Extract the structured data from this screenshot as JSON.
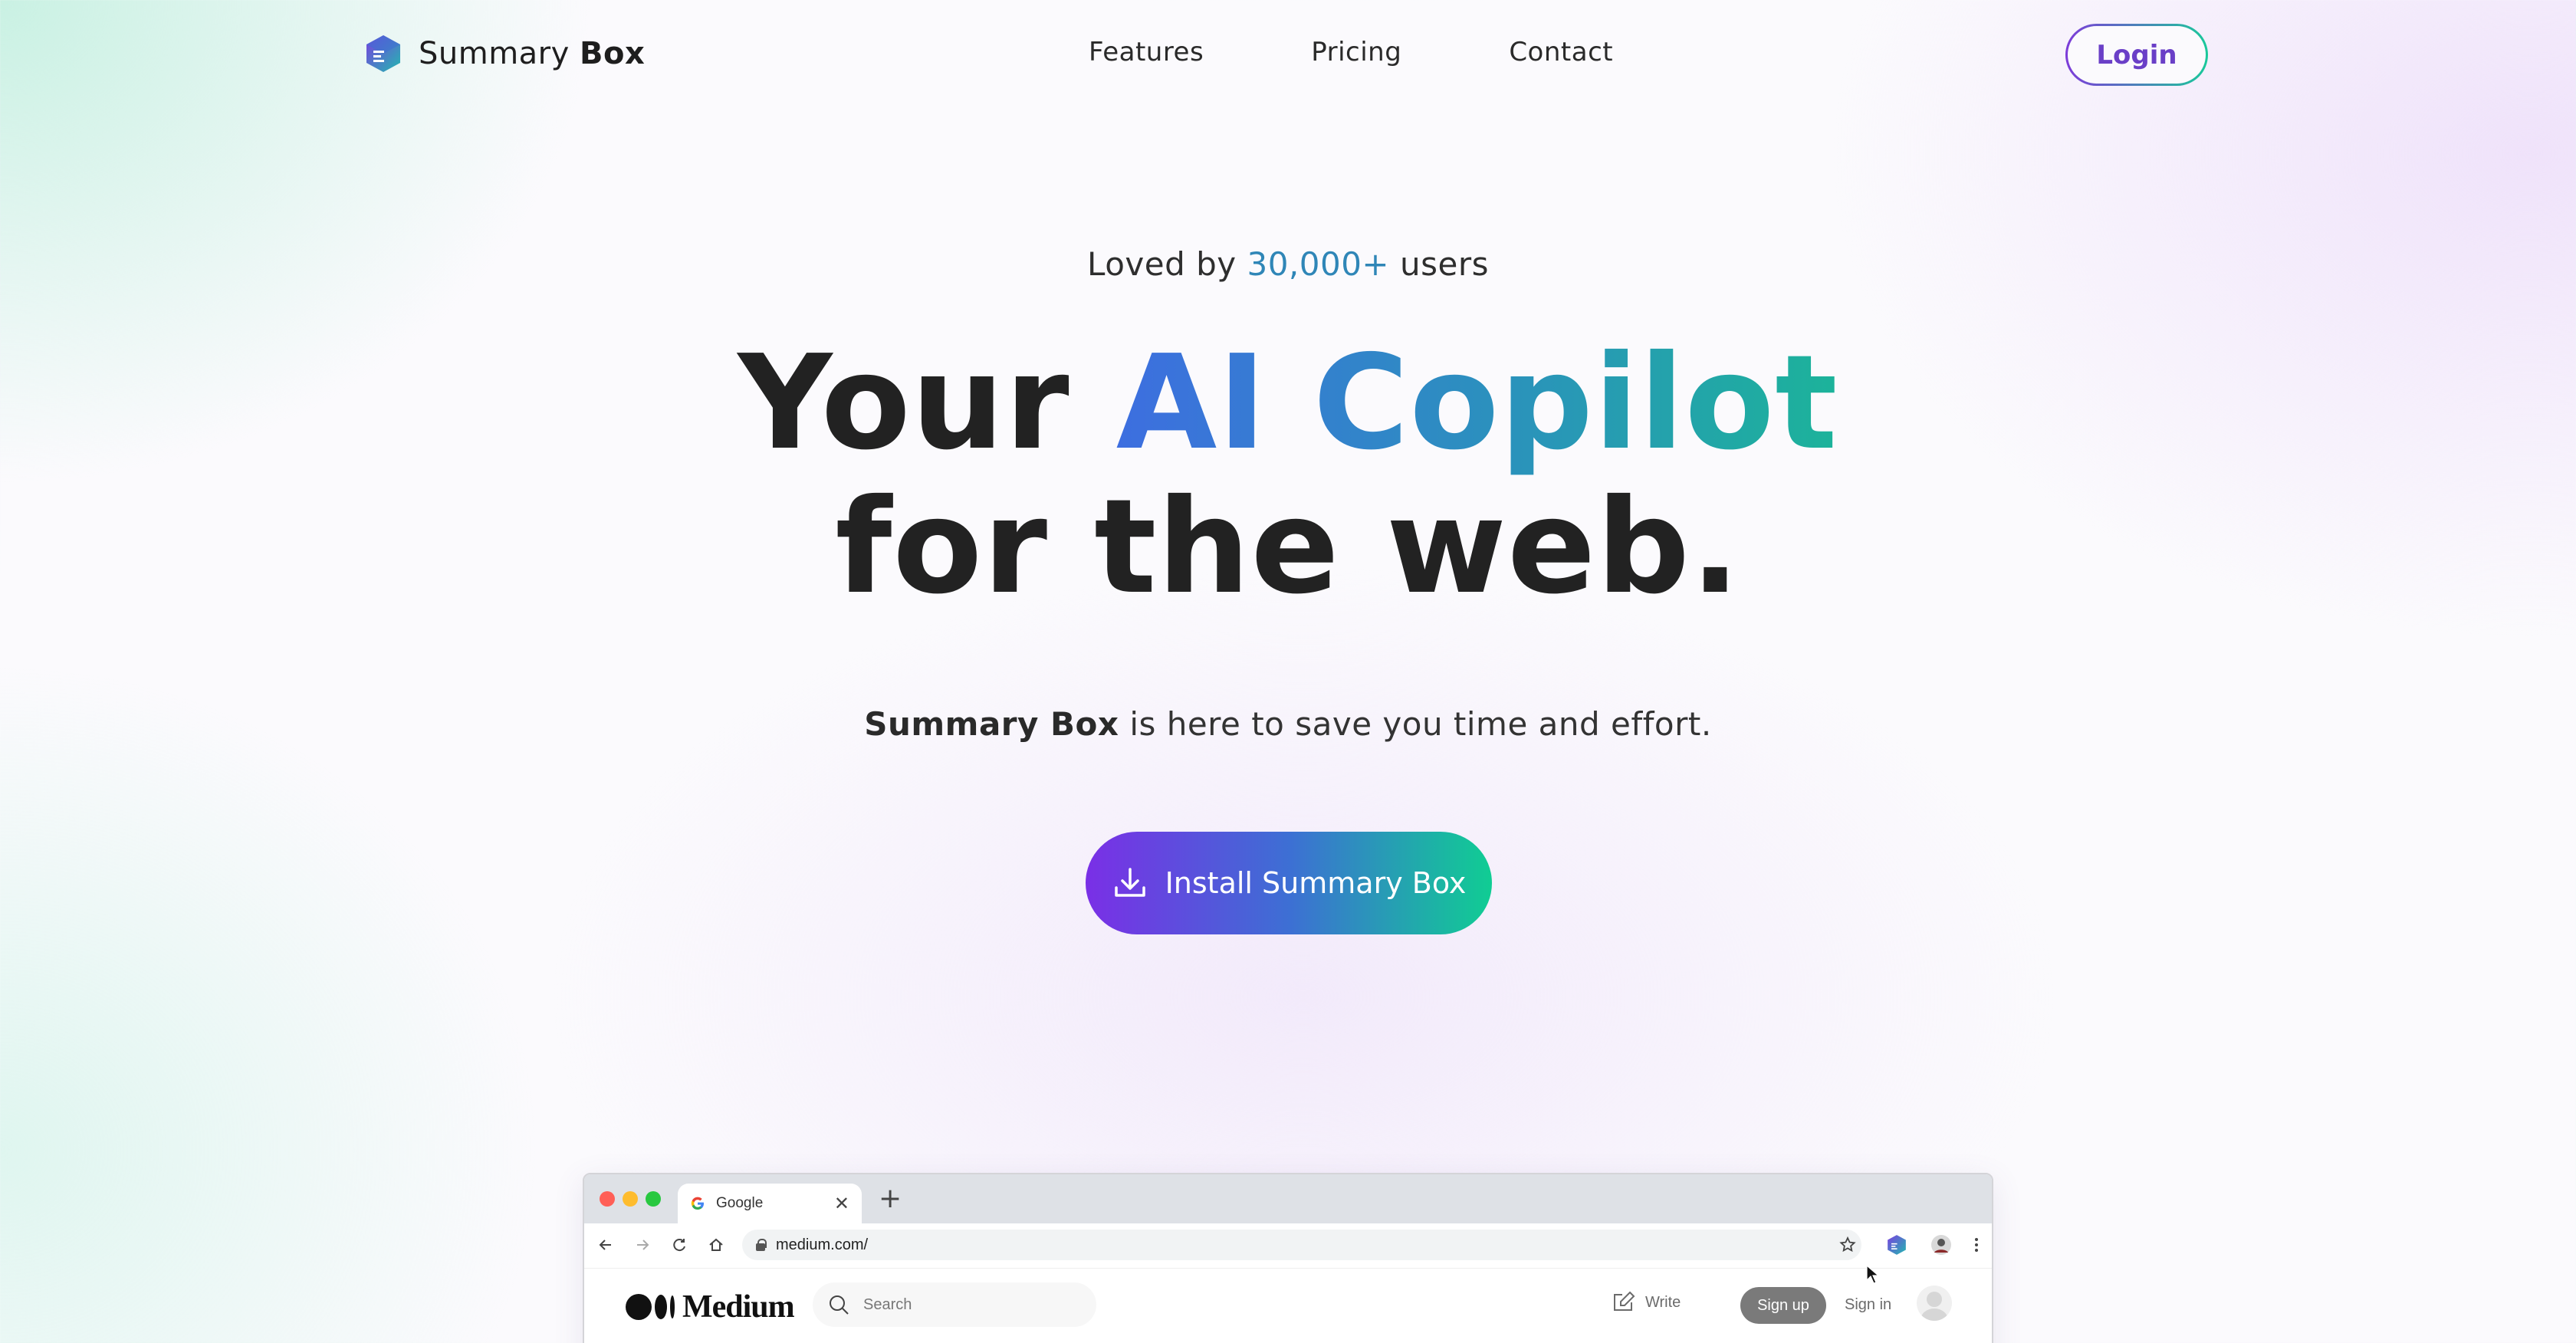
{
  "brand": {
    "name_regular": "Summary ",
    "name_bold": "Box"
  },
  "nav": {
    "links": [
      "Features",
      "Pricing",
      "Contact"
    ],
    "login_label": "Login"
  },
  "hero": {
    "loved_prefix": "Loved by ",
    "loved_count": "30,000+",
    "loved_suffix": " users",
    "headline_part1": "Your ",
    "headline_highlight": "AI Copilot",
    "headline_line2": "for the web.",
    "sub_bold": "Summary Box",
    "sub_rest": " is here to save you time and effort.",
    "install_label": "Install Summary Box"
  },
  "browser": {
    "tab_title": "Google",
    "tab_close": "✕",
    "new_tab": "+",
    "url": "medium.com/",
    "site": {
      "logo_text": "Medium",
      "search_placeholder": "Search",
      "write_label": "Write",
      "signup_label": "Sign up",
      "signin_label": "Sign in"
    }
  },
  "colors": {
    "accent_purple": "#7a2fe6",
    "accent_teal": "#10cd93",
    "highlight_blue": "#2f86b7"
  }
}
